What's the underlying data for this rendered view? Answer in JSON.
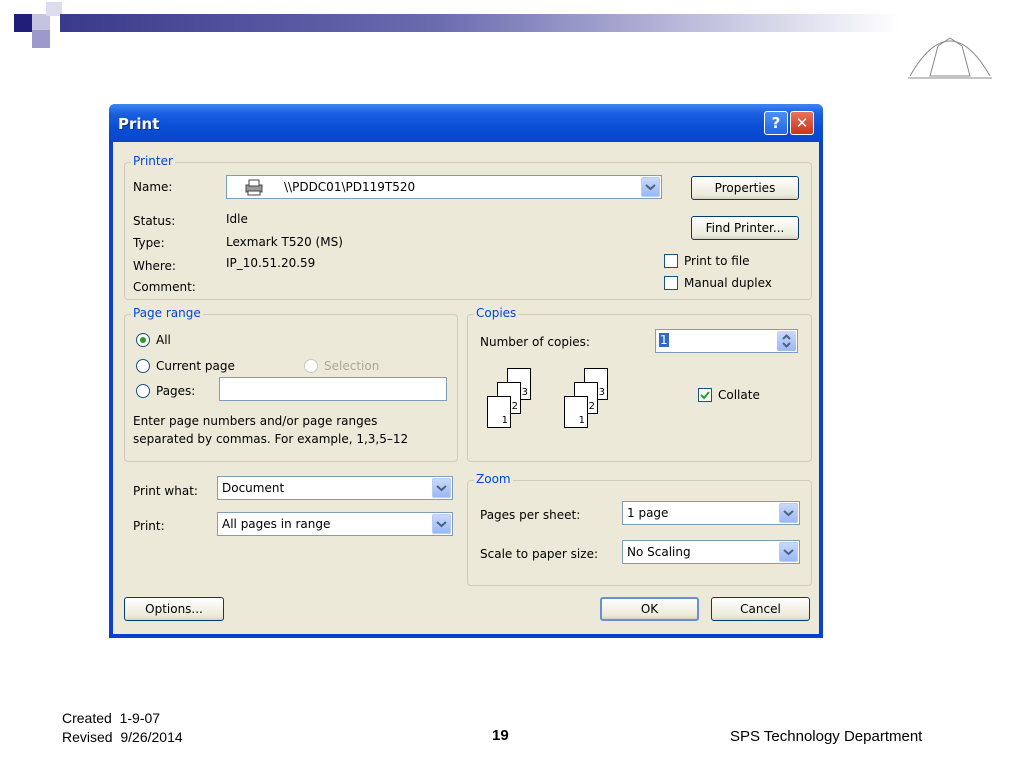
{
  "dialog": {
    "title": "Print",
    "help_button": "?",
    "close_button": "✕"
  },
  "printer": {
    "legend": "Printer",
    "name_label": "Name:",
    "name_value": "\\\\PDDC01\\PD119T520",
    "status_label": "Status:",
    "status_value": "Idle",
    "type_label": "Type:",
    "type_value": "Lexmark T520 (MS)",
    "where_label": "Where:",
    "where_value": "IP_10.51.20.59",
    "comment_label": "Comment:",
    "properties_button": "Properties",
    "find_printer_button": "Find Printer...",
    "print_to_file": "Print to file",
    "manual_duplex": "Manual duplex"
  },
  "page_range": {
    "legend": "Page range",
    "all": "All",
    "current_page": "Current page",
    "selection": "Selection",
    "pages": "Pages:",
    "hint_line1": "Enter page numbers and/or page ranges",
    "hint_line2": "separated by commas.  For example, 1,3,5–12"
  },
  "copies": {
    "legend": "Copies",
    "number_label": "Number of copies:",
    "number_value": "1",
    "collate": "Collate",
    "collate_checked": true,
    "page_numbers": [
      "3",
      "2",
      "1"
    ]
  },
  "print_what": {
    "label": "Print what:",
    "value": "Document"
  },
  "print_range": {
    "label": "Print:",
    "value": "All pages in range"
  },
  "zoom": {
    "legend": "Zoom",
    "pages_per_sheet_label": "Pages per sheet:",
    "pages_per_sheet_value": "1 page",
    "scale_label": "Scale to paper size:",
    "scale_value": "No Scaling"
  },
  "buttons": {
    "options": "Options...",
    "ok": "OK",
    "cancel": "Cancel"
  },
  "footer": {
    "created": "Created  1-9-07",
    "revised": "Revised  9/26/2014",
    "page_number": "19",
    "department": "SPS Technology Department"
  },
  "colors": {
    "title_bar": "#0a4fd8",
    "dialog_face": "#ece9d8",
    "group_label": "#0046d5",
    "slide_bar": "#3a3a8c"
  }
}
